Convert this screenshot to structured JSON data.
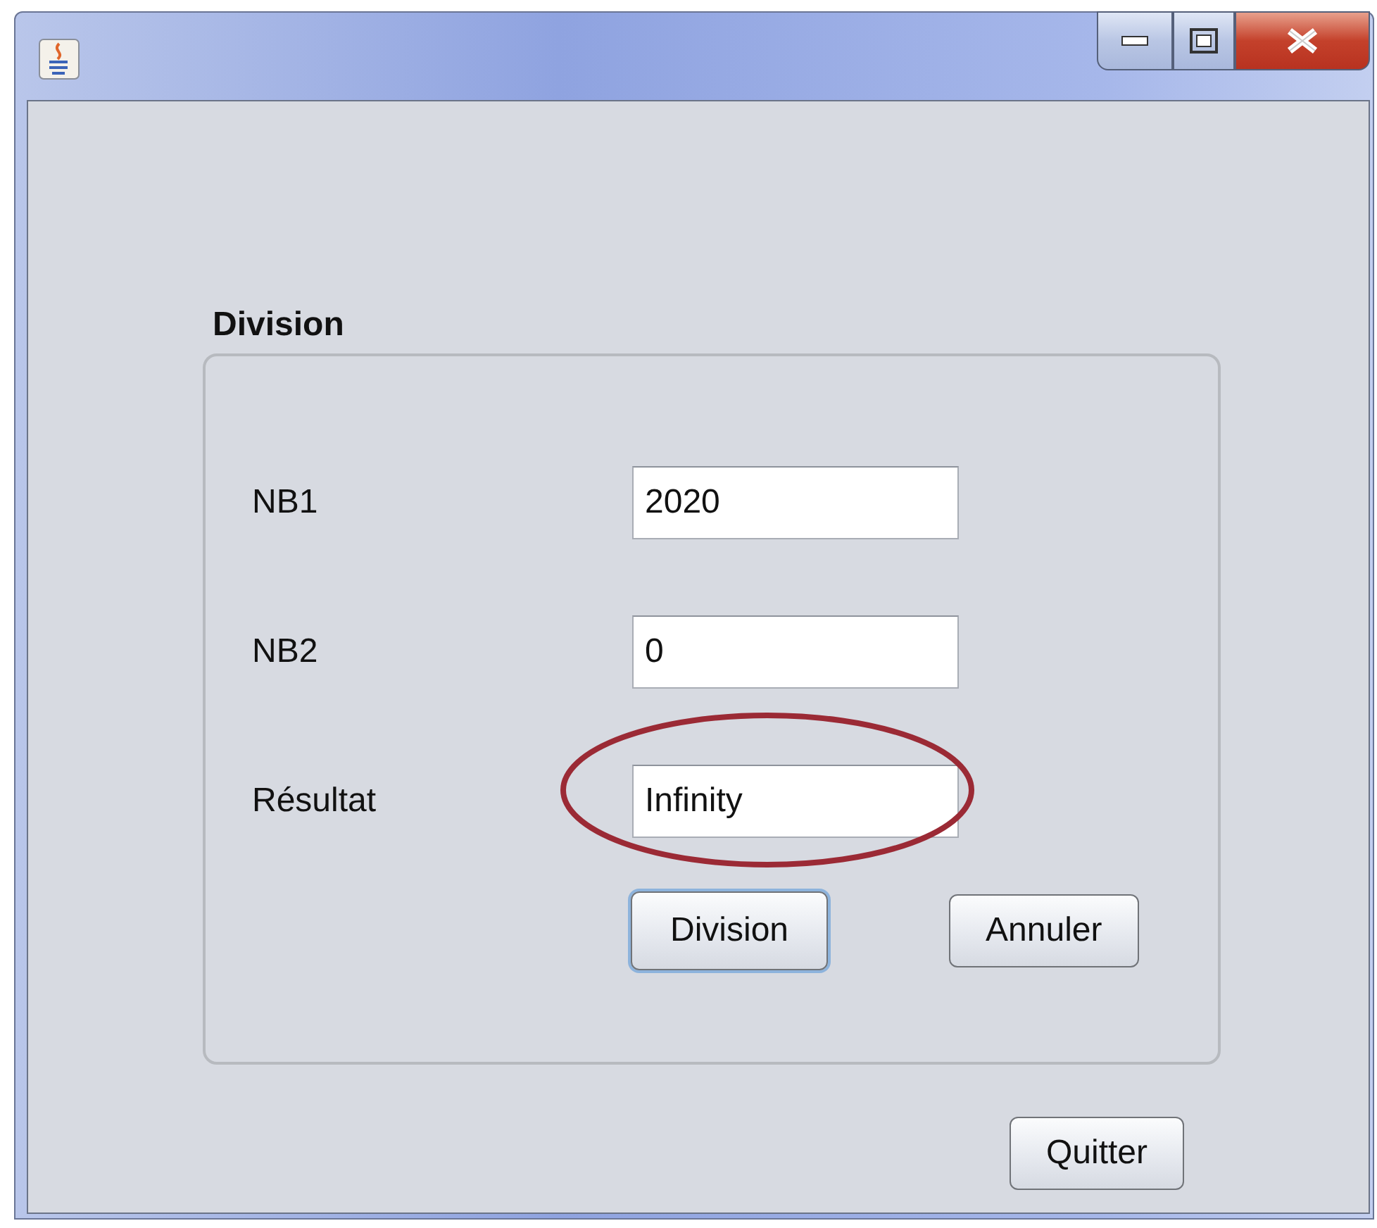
{
  "window": {
    "controls": [
      {
        "kind": "minimize"
      },
      {
        "kind": "maximize"
      },
      {
        "kind": "close"
      }
    ]
  },
  "group": {
    "title": "Division",
    "fields": [
      {
        "label": "NB1",
        "value": "2020",
        "highlighted": false
      },
      {
        "label": "NB2",
        "value": "0",
        "highlighted": false
      },
      {
        "label": "Résultat",
        "value": "Infinity",
        "highlighted": true
      }
    ],
    "buttons": [
      {
        "label": "Division",
        "focused": true
      },
      {
        "label": "Annuler",
        "focused": false
      }
    ]
  },
  "footer_buttons": [
    {
      "label": "Quitter",
      "focused": false
    }
  ]
}
